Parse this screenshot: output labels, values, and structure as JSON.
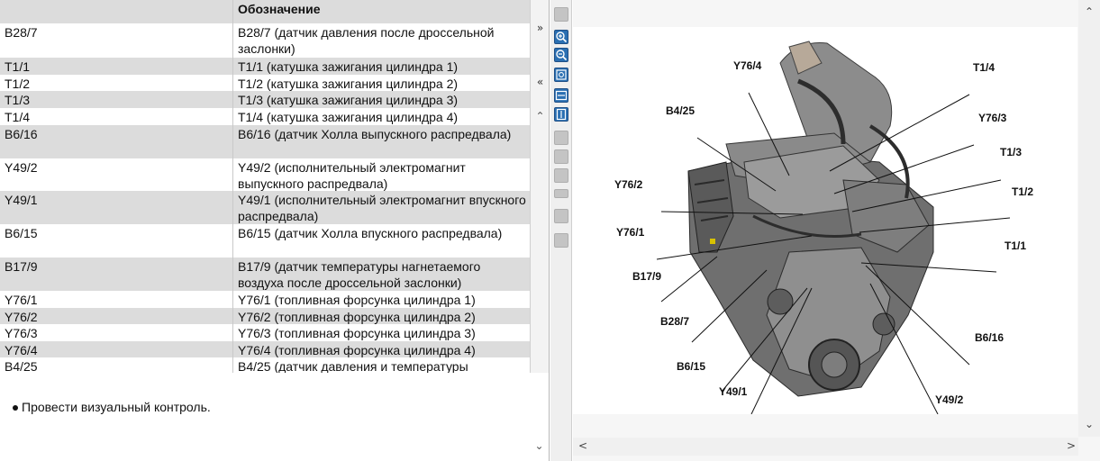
{
  "table": {
    "header": {
      "designation": "",
      "description": "Обозначение"
    },
    "rows": [
      {
        "code": "B28/7",
        "text": "B28/7 (датчик давления после дроссельной заслонки)"
      },
      {
        "code": "T1/1",
        "text": "T1/1 (катушка зажигания цилиндра 1)"
      },
      {
        "code": "T1/2",
        "text": "T1/2 (катушка зажигания цилиндра 2)"
      },
      {
        "code": "T1/3",
        "text": "T1/3 (катушка зажигания цилиндра 3)"
      },
      {
        "code": "T1/4",
        "text": "T1/4 (катушка зажигания цилиндра 4)"
      },
      {
        "code": "B6/16",
        "text": "B6/16 (датчик Холла выпускного распредвала)"
      },
      {
        "code": "Y49/2",
        "text": "Y49/2 (исполнительный электромагнит выпускного распредвала)"
      },
      {
        "code": "Y49/1",
        "text": "Y49/1 (исполнительный электромагнит впускного распредвала)"
      },
      {
        "code": "B6/15",
        "text": "B6/15 (датчик Холла впускного распредвала)"
      },
      {
        "code": "B17/9",
        "text": "B17/9 (датчик температуры нагнетаемого воздуха после дроссельной заслонки)"
      },
      {
        "code": "Y76/1",
        "text": "Y76/1 (топливная форсунка цилиндра 1)"
      },
      {
        "code": "Y76/2",
        "text": "Y76/2 (топливная форсунка цилиндра 2)"
      },
      {
        "code": "Y76/3",
        "text": "Y76/3 (топливная форсунка цилиндра 3)"
      },
      {
        "code": "Y76/4",
        "text": "Y76/4 (топливная форсунка цилиндра 4)"
      },
      {
        "code": "B4/25",
        "text": "B4/25 (датчик давления и температуры"
      }
    ]
  },
  "scroll": {
    "collapse_right": "»",
    "collapse_left": "«",
    "up_arrow": "⌃",
    "down_arrow": "⌄",
    "left_arrow": "<",
    "right_arrow": ">"
  },
  "note": "Провести визуальный контроль.",
  "toolbar": {
    "buttons": [
      {
        "name": "zoom-in-icon",
        "state": "active"
      },
      {
        "name": "zoom-out-icon",
        "state": "active"
      },
      {
        "name": "zoom-fit-icon",
        "state": "active"
      },
      {
        "name": "fit-width-icon",
        "state": "active"
      },
      {
        "name": "fit-height-icon",
        "state": "active"
      },
      {
        "name": "page-icon",
        "state": "disabled"
      },
      {
        "name": "page-icon",
        "state": "disabled"
      },
      {
        "name": "page-icon",
        "state": "disabled"
      },
      {
        "name": "page-icon",
        "state": "disabled"
      },
      {
        "name": "play-icon",
        "state": "disabled"
      },
      {
        "name": "list-icon",
        "state": "disabled"
      }
    ]
  },
  "image": {
    "callouts": {
      "y76_4": "Y76/4",
      "t1_4": "T1/4",
      "b4_25": "B4/25",
      "y76_3": "Y76/3",
      "t1_3": "T1/3",
      "y76_2": "Y76/2",
      "t1_2": "T1/2",
      "y76_1": "Y76/1",
      "t1_1": "T1/1",
      "b17_9": "B17/9",
      "b28_7": "B28/7",
      "b6_16": "B6/16",
      "b6_15": "B6/15",
      "y49_1": "Y49/1",
      "y49_2": "Y49/2"
    }
  },
  "colors": {
    "row_alt": "#dcdcdc",
    "toolbar_active": "#2a6fb2",
    "toolbar_disabled": "#c4c4c4"
  }
}
